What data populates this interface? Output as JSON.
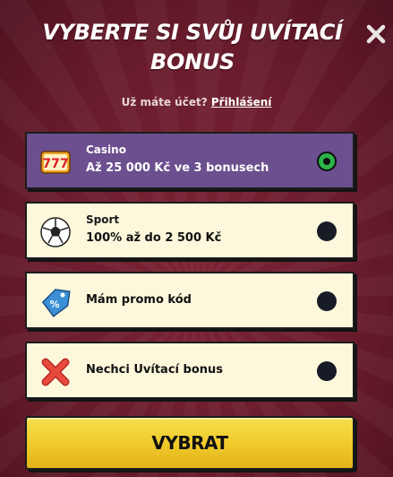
{
  "dialog": {
    "title_line1": "VYBERTE SI SVŮJ UVÍTACÍ",
    "title_line2": "BONUS",
    "login_prompt": "Už máte účet?",
    "login_link": "Přihlášení"
  },
  "options": [
    {
      "label": "Casino",
      "detail": "Až 25 000 Kč ve 3 bonusech",
      "icon": "slot-777-icon",
      "selected": true
    },
    {
      "label": "Sport",
      "detail": "100% až do 2 500 Kč",
      "icon": "soccer-ball-icon",
      "selected": false
    },
    {
      "label": "Mám promo kód",
      "icon": "percent-tag-icon",
      "selected": false
    },
    {
      "label": "Nechci Uvítací bonus",
      "icon": "red-x-icon",
      "selected": false
    }
  ],
  "cta": {
    "label": "VYBRAT"
  },
  "colors": {
    "background": "#6a1c2c",
    "selected_option": "#6b4f8e",
    "option": "#fdf8dc",
    "radio_selected": "#2bb54b",
    "cta": "#efc92a"
  }
}
